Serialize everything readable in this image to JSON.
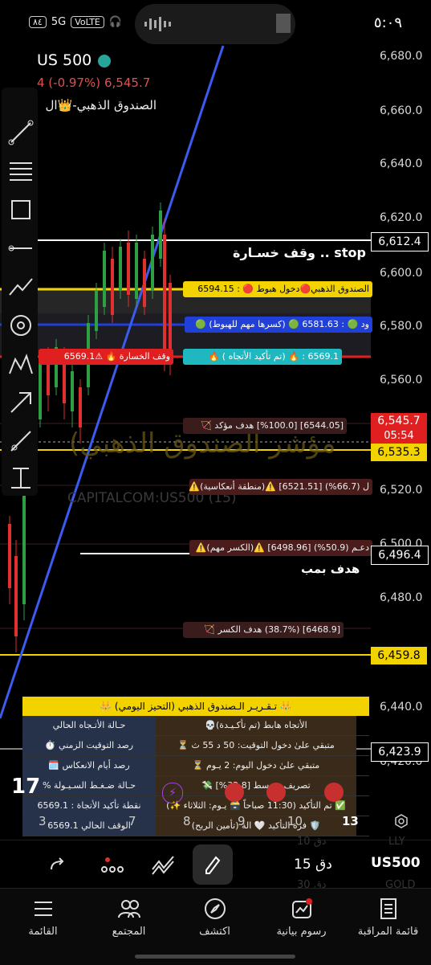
{
  "status_bar": {
    "time": "٥:٠٩",
    "left_items": [
      "٨٤",
      "5G",
      "VoLTE"
    ]
  },
  "header": {
    "symbol": "US 500",
    "change": "4 (-0.97%)",
    "price": "6,545.7",
    "indicator_name": "الصندوق الذهبي-👑ال"
  },
  "price_axis": [
    "6,680.0",
    "6,660.0",
    "6,640.0",
    "6,620.0",
    "6,600.0",
    "6,580.0",
    "6,560.0",
    "6,520.0",
    "6,500.0",
    "6,480.0",
    "6,440.0",
    "6,420.0"
  ],
  "price_tags": {
    "stop": "6,612.4",
    "current": "6,545.7",
    "countdown": "05:54",
    "entry": "6,535.3",
    "pump": "6,496.4",
    "lower": "6,459.8",
    "bottom": "6,423.9"
  },
  "chart_labels": {
    "stop_loss": "stop .. وقف خسـارة",
    "pump_target": "هدف بمب",
    "gold_sell": "الصندوق الذهبي🔴دخول هبوط 🔴 : 6594.15",
    "blue_zone": "ود 🟢 : 6581.63 🟢 (كسرها مهم للهبوط) 🟢",
    "confirm": "6569.1 : 🔥 (تم تأكيد الأتجاه ) 🔥",
    "stop_tag": "وقف الخسارة 🔥 ⚠6569.1",
    "confirmed_target": "[6544.05] [%100.0] هدف مؤكد 🏹",
    "reversal": "ل (66.7%) [6521.51] ⚠️(منطقة أنعكاسية)⚠️",
    "support": "دعـم (50.9%) [6498.96] ⚠️(الكسر مهم)⚠️",
    "break_target": "[6468.9] (38.7%) هدف الكسر 🏹",
    "watermark": "(مؤشر الصندوق الذهبي",
    "source": "CAPITALCOM:US500 (15)"
  },
  "report": {
    "title": "👑 تـقـريـر الـصندوق الذهبي (التحيز اليومي) 👑",
    "rows": [
      {
        "value": "الأتجاه هابط (تم تأكـيـدة)💀",
        "label": "حـالة الأتـجاه الحالي"
      },
      {
        "value": "متبقي علىٰ دخول التوقيت: 50 د 55 ث ⏳",
        "label": "رصد التوقيت الزمني ⏱️"
      },
      {
        "value": "متبقي علىٰ دخول اليوم: 2 يـوم ⏳",
        "label": "رصد أيام الانعكاس 🗓️"
      },
      {
        "value": "تصريف متوسط [32.8%] 💸",
        "label": "حـالة ضـغـط السـيـولة %"
      },
      {
        "value": "✅ تم التأكيد (11:30 صباحاً 🗃️ يـوم: الثلاثاء ✨)",
        "label": "نقطة تأكيد الأتجاة : 6569.1"
      },
      {
        "value": "🛡️ فزة التأكيد 🤍 الة (تأمين الربح)",
        "label": "الوقف الحالي 6569.1"
      }
    ]
  },
  "x_axis": [
    "3",
    "7",
    "8",
    "9",
    "10",
    "13"
  ],
  "toolbar": {
    "timeframe": "15 دق",
    "symbol": "US500",
    "faded_top": "10 دق",
    "faded_bottom": "30 دق",
    "faded_sym_top": "LLY",
    "faded_sym_bottom": "GOLD"
  },
  "nav": [
    {
      "label": "قائمة المراقبة",
      "icon": "watchlist-icon"
    },
    {
      "label": "رسوم بيانية",
      "icon": "chart-icon"
    },
    {
      "label": "اكتشف",
      "icon": "compass-icon"
    },
    {
      "label": "المجتمع",
      "icon": "community-icon"
    },
    {
      "label": "القائمة",
      "icon": "menu-icon"
    }
  ],
  "colors": {
    "gold": "#f2d300",
    "blue": "#2040d8",
    "red": "#e02020",
    "teal": "#20b8c0",
    "trend": "#3a5cf0"
  }
}
